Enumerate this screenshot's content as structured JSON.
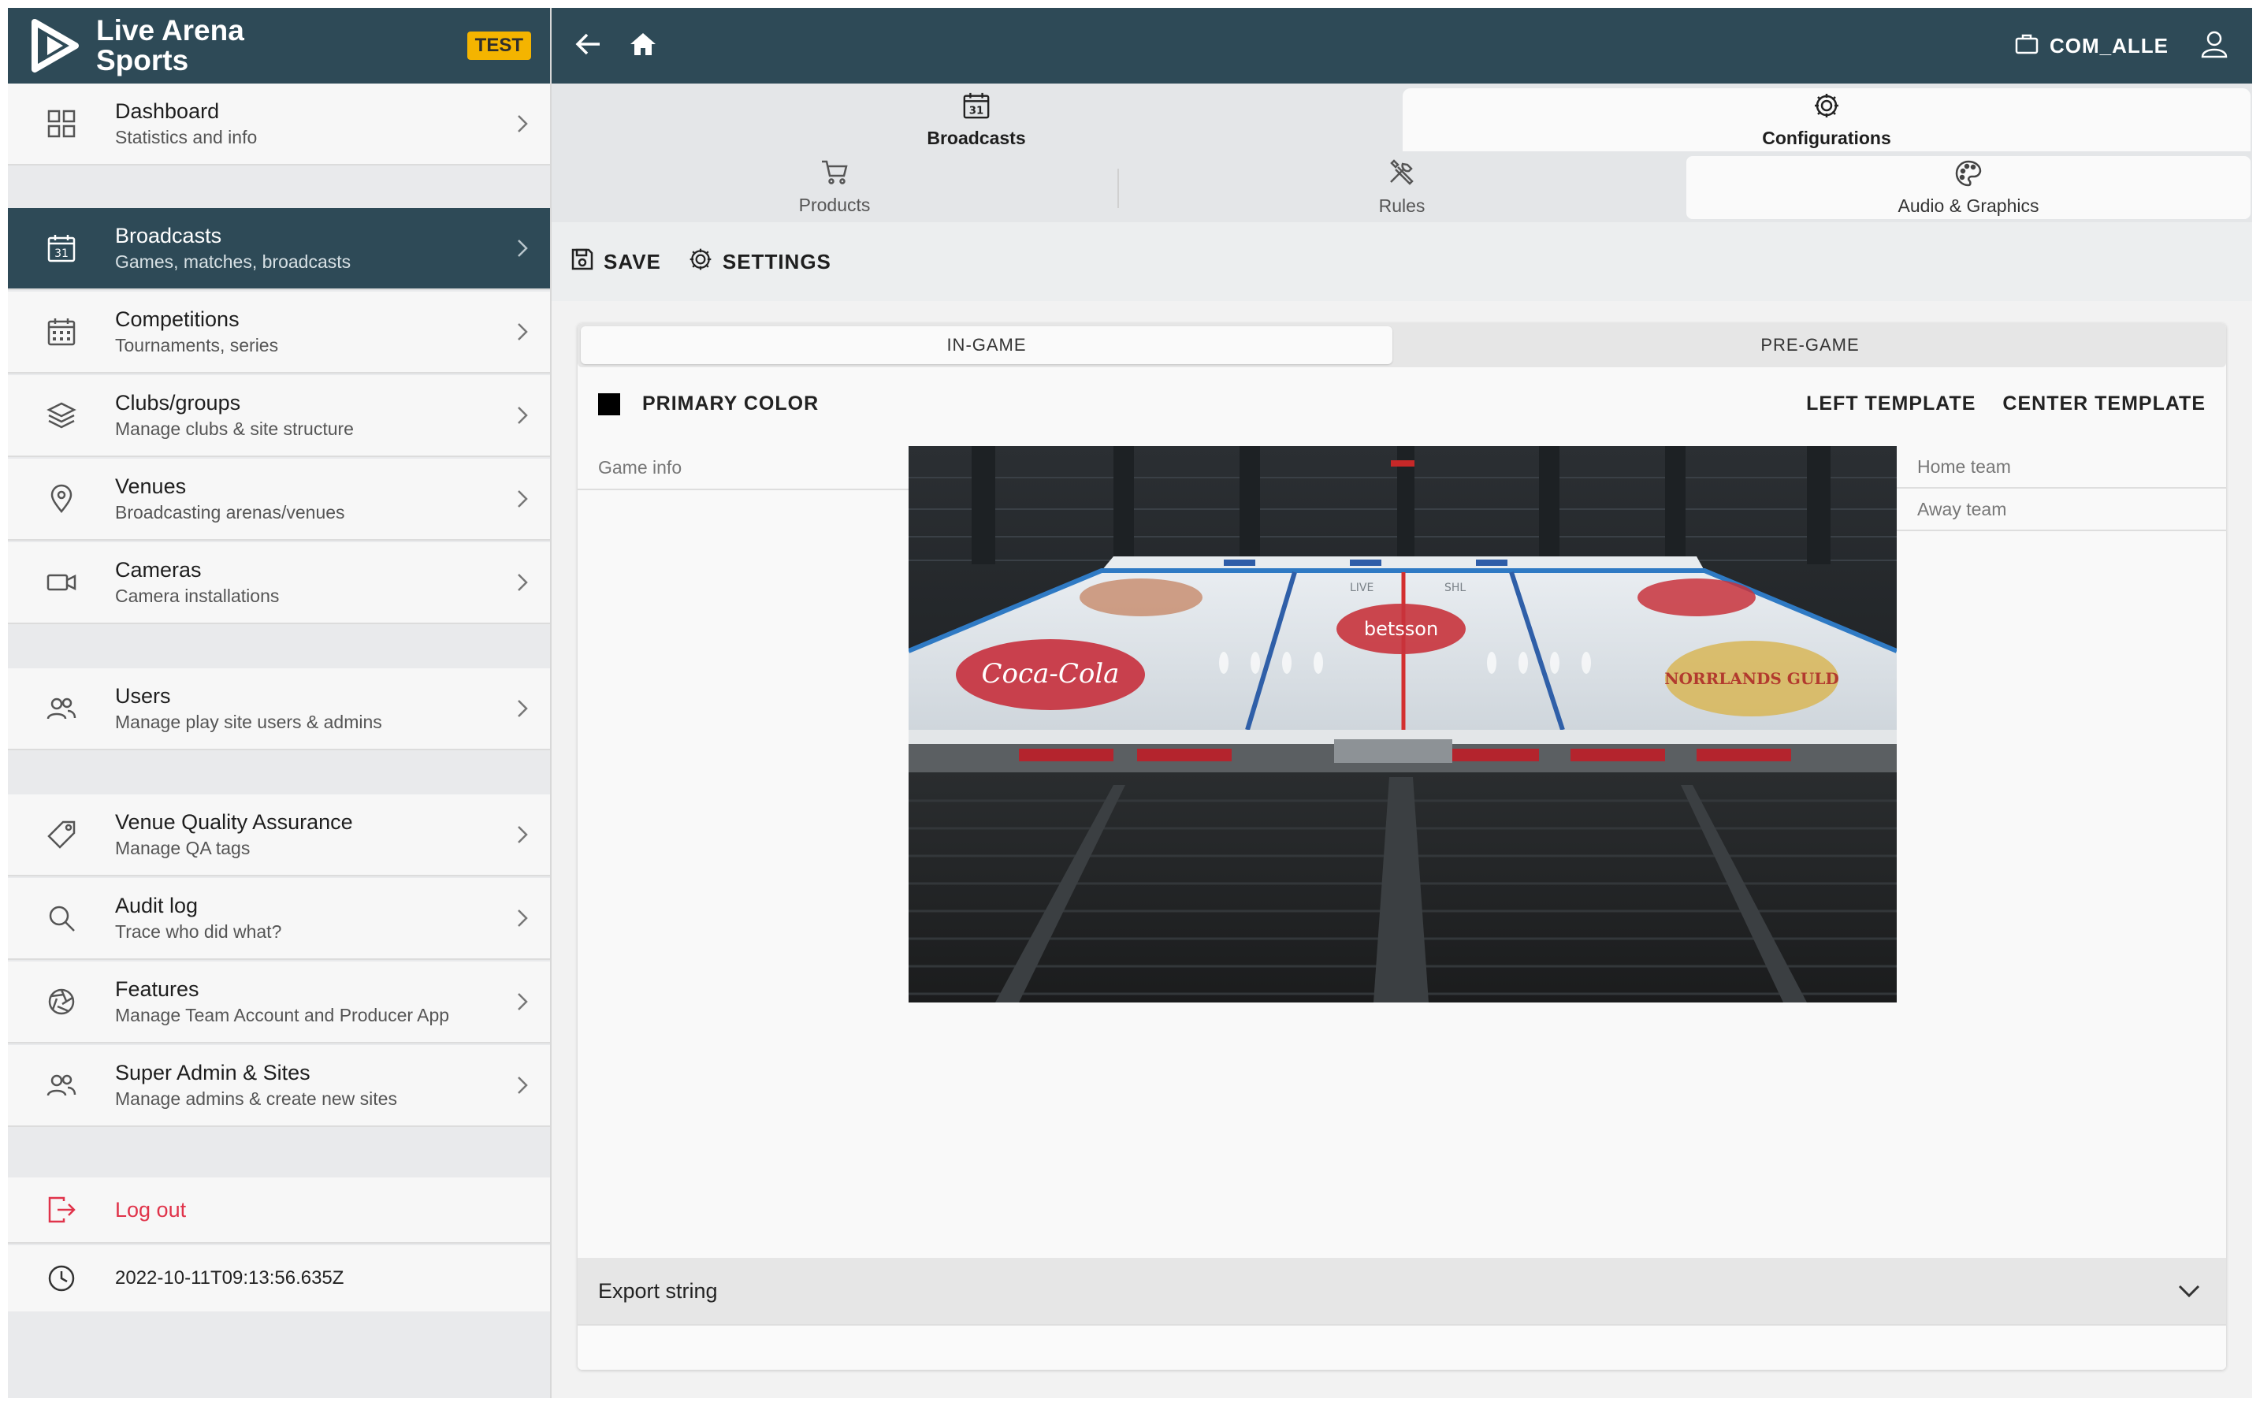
{
  "app": {
    "brand_name": "Live Arena Sports",
    "env_badge": "TEST",
    "brand_color": "#2e4a57",
    "accent_color": "#f4b400"
  },
  "sidebar": {
    "items": [
      {
        "title": "Dashboard",
        "subtitle": "Statistics and info",
        "icon": "grid-icon"
      },
      {
        "title": "Broadcasts",
        "subtitle": "Games, matches, broadcasts",
        "icon": "calendar-icon",
        "active": true
      },
      {
        "title": "Competitions",
        "subtitle": "Tournaments, series",
        "icon": "calendar-grid-icon"
      },
      {
        "title": "Clubs/groups",
        "subtitle": "Manage clubs & site structure",
        "icon": "layers-icon"
      },
      {
        "title": "Venues",
        "subtitle": "Broadcasting arenas/venues",
        "icon": "location-pin-icon"
      },
      {
        "title": "Cameras",
        "subtitle": "Camera installations",
        "icon": "video-camera-icon"
      },
      {
        "title": "Users",
        "subtitle": "Manage play site users & admins",
        "icon": "users-icon"
      },
      {
        "title": "Venue Quality Assurance",
        "subtitle": "Manage QA tags",
        "icon": "tag-icon"
      },
      {
        "title": "Audit log",
        "subtitle": "Trace who did what?",
        "icon": "search-icon"
      },
      {
        "title": "Features",
        "subtitle": "Manage Team Account and Producer App",
        "icon": "aperture-icon"
      },
      {
        "title": "Super Admin & Sites",
        "subtitle": "Manage admins & create new sites",
        "icon": "admins-icon"
      }
    ],
    "logout_label": "Log out",
    "timestamp": "2022-10-11T09:13:56.635Z"
  },
  "topbar": {
    "org_name": "COM_ALLE",
    "back_icon": "arrow-left-icon",
    "home_icon": "home-icon",
    "user_icon": "user-icon"
  },
  "tabs_primary": [
    {
      "label": "Broadcasts",
      "icon": "calendar-icon"
    },
    {
      "label": "Configurations",
      "icon": "gear-icon",
      "active": true
    }
  ],
  "tabs_secondary": [
    {
      "label": "Products",
      "icon": "cart-icon"
    },
    {
      "label": "Rules",
      "icon": "tools-icon"
    },
    {
      "label": "Audio & Graphics",
      "icon": "palette-icon",
      "active": true
    }
  ],
  "toolbar": {
    "save_label": "SAVE",
    "settings_label": "SETTINGS"
  },
  "editor": {
    "segments": [
      {
        "label": "IN-GAME",
        "active": true
      },
      {
        "label": "PRE-GAME",
        "active": false
      }
    ],
    "primary_color_label": "PRIMARY COLOR",
    "primary_color": "#000000",
    "left_template_label": "LEFT TEMPLATE",
    "center_template_label": "CENTER TEMPLATE",
    "game_info_label": "Game info",
    "home_team_label": "Home team",
    "away_team_label": "Away team",
    "preview_texts": {
      "cocacola": "Coca-Cola",
      "betsson": "betsson",
      "gulf": "NORRLANDS GULD",
      "live": "LIVE",
      "shl": "SHL"
    },
    "export_label": "Export string"
  }
}
